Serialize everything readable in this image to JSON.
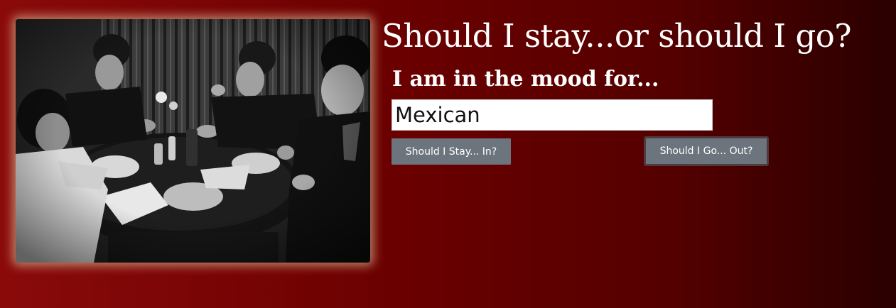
{
  "hero_image": {
    "alt": "Band seated around a restaurant table eating dinner"
  },
  "headline": "Should I stay...or should I go?",
  "mood_label": "I am in the mood for...",
  "food_input": {
    "value": "Mexican"
  },
  "buttons": {
    "stay_label": "Should I Stay... In?",
    "go_label": "Should I Go... Out?"
  },
  "colors": {
    "background_start": "#8a0a0a",
    "background_end": "#2a0000",
    "button": "#6c757d",
    "text": "#ffffff"
  }
}
